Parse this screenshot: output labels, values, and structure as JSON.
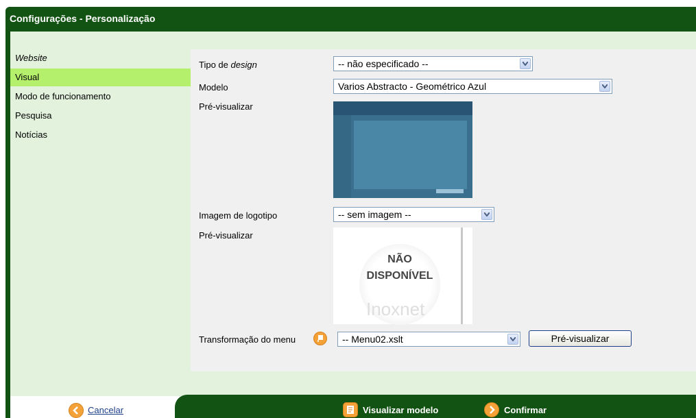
{
  "window": {
    "title": "Configurações - Personalização"
  },
  "sidebar": {
    "items": [
      {
        "label": "Website",
        "style": "italic"
      },
      {
        "label": "Visual",
        "active": true
      },
      {
        "label": "Modo de funcionamento"
      },
      {
        "label": "Pesquisa"
      },
      {
        "label": "Notícias"
      }
    ]
  },
  "form": {
    "tipo_design": {
      "label_prefix": "Tipo de ",
      "label_em": "design",
      "value": "-- não especificado --"
    },
    "modelo": {
      "label": "Modelo",
      "value": "Varios Abstracto - Geométrico Azul"
    },
    "preview1": {
      "label": "Pré-visualizar"
    },
    "imagem_logotipo": {
      "label": "Imagem de logotipo",
      "value": "-- sem imagem --"
    },
    "preview2": {
      "label": "Pré-visualizar",
      "line1": "NÃO",
      "line2": "DISPONÍVEL",
      "brand": "Inoxnet"
    },
    "transformacao_menu": {
      "label": "Transformação do menu",
      "value": "-- Menu02.xslt",
      "button": "Pré-visualizar"
    }
  },
  "footer": {
    "cancel": "Cancelar",
    "visualizar_modelo": "Visualizar modelo",
    "confirmar": "Confirmar"
  },
  "colors": {
    "header_green": "#125212",
    "panel_green": "#e3f2dd",
    "active_item": "#b5f06d",
    "icon_orange": "#f4a238"
  }
}
